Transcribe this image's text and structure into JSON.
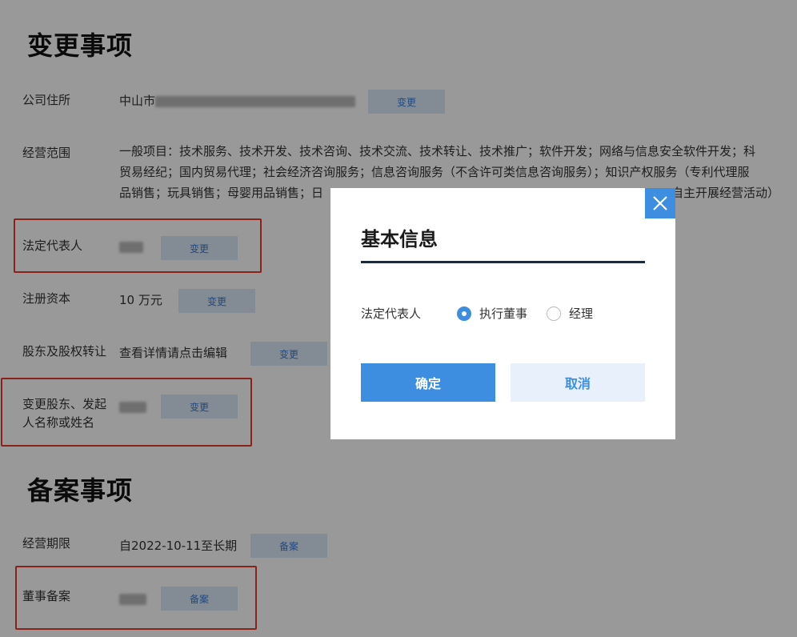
{
  "sections": {
    "change_title": "变更事项",
    "filing_title": "备案事项"
  },
  "rows": {
    "address": {
      "label": "公司住所",
      "value_prefix": "中山市",
      "button": "变更"
    },
    "scope": {
      "label": "经营范围",
      "lines": [
        "一般项目：技术服务、技术开发、技术咨询、技术交流、技术转让、技术推广；软件开发；网络与信息安全软件开发；科",
        "贸易经纪；国内贸易代理；社会经济咨询服务；信息咨询服务（不含许可类信息咨询服务）；知识产权服务（专利代理服",
        "品销售；玩具销售；母婴用品销售；日"
      ],
      "line3_tail": "自主开展经营活动）"
    },
    "legal_rep": {
      "label": "法定代表人",
      "button": "变更"
    },
    "capital": {
      "label": "注册资本",
      "value": "10 万元",
      "button": "变更"
    },
    "equity": {
      "label": "股东及股权转让",
      "value": "查看详情请点击编辑",
      "button": "变更"
    },
    "shareholder_name": {
      "label": "变更股东、发起人名称或姓名",
      "button": "变更"
    },
    "term": {
      "label": "经营期限",
      "value": "自2022-10-11至长期",
      "button": "备案"
    },
    "directors": {
      "label": "董事备案",
      "button": "备案"
    }
  },
  "modal": {
    "title": "基本信息",
    "field_label": "法定代表人",
    "options": [
      {
        "label": "执行董事",
        "checked": true
      },
      {
        "label": "经理",
        "checked": false
      }
    ],
    "confirm": "确定",
    "cancel": "取消",
    "close_icon": "close-icon"
  },
  "colors": {
    "accent": "#3d8ee0",
    "highlight_box": "#e63a2e",
    "button_bg": "#dbe8f7"
  }
}
